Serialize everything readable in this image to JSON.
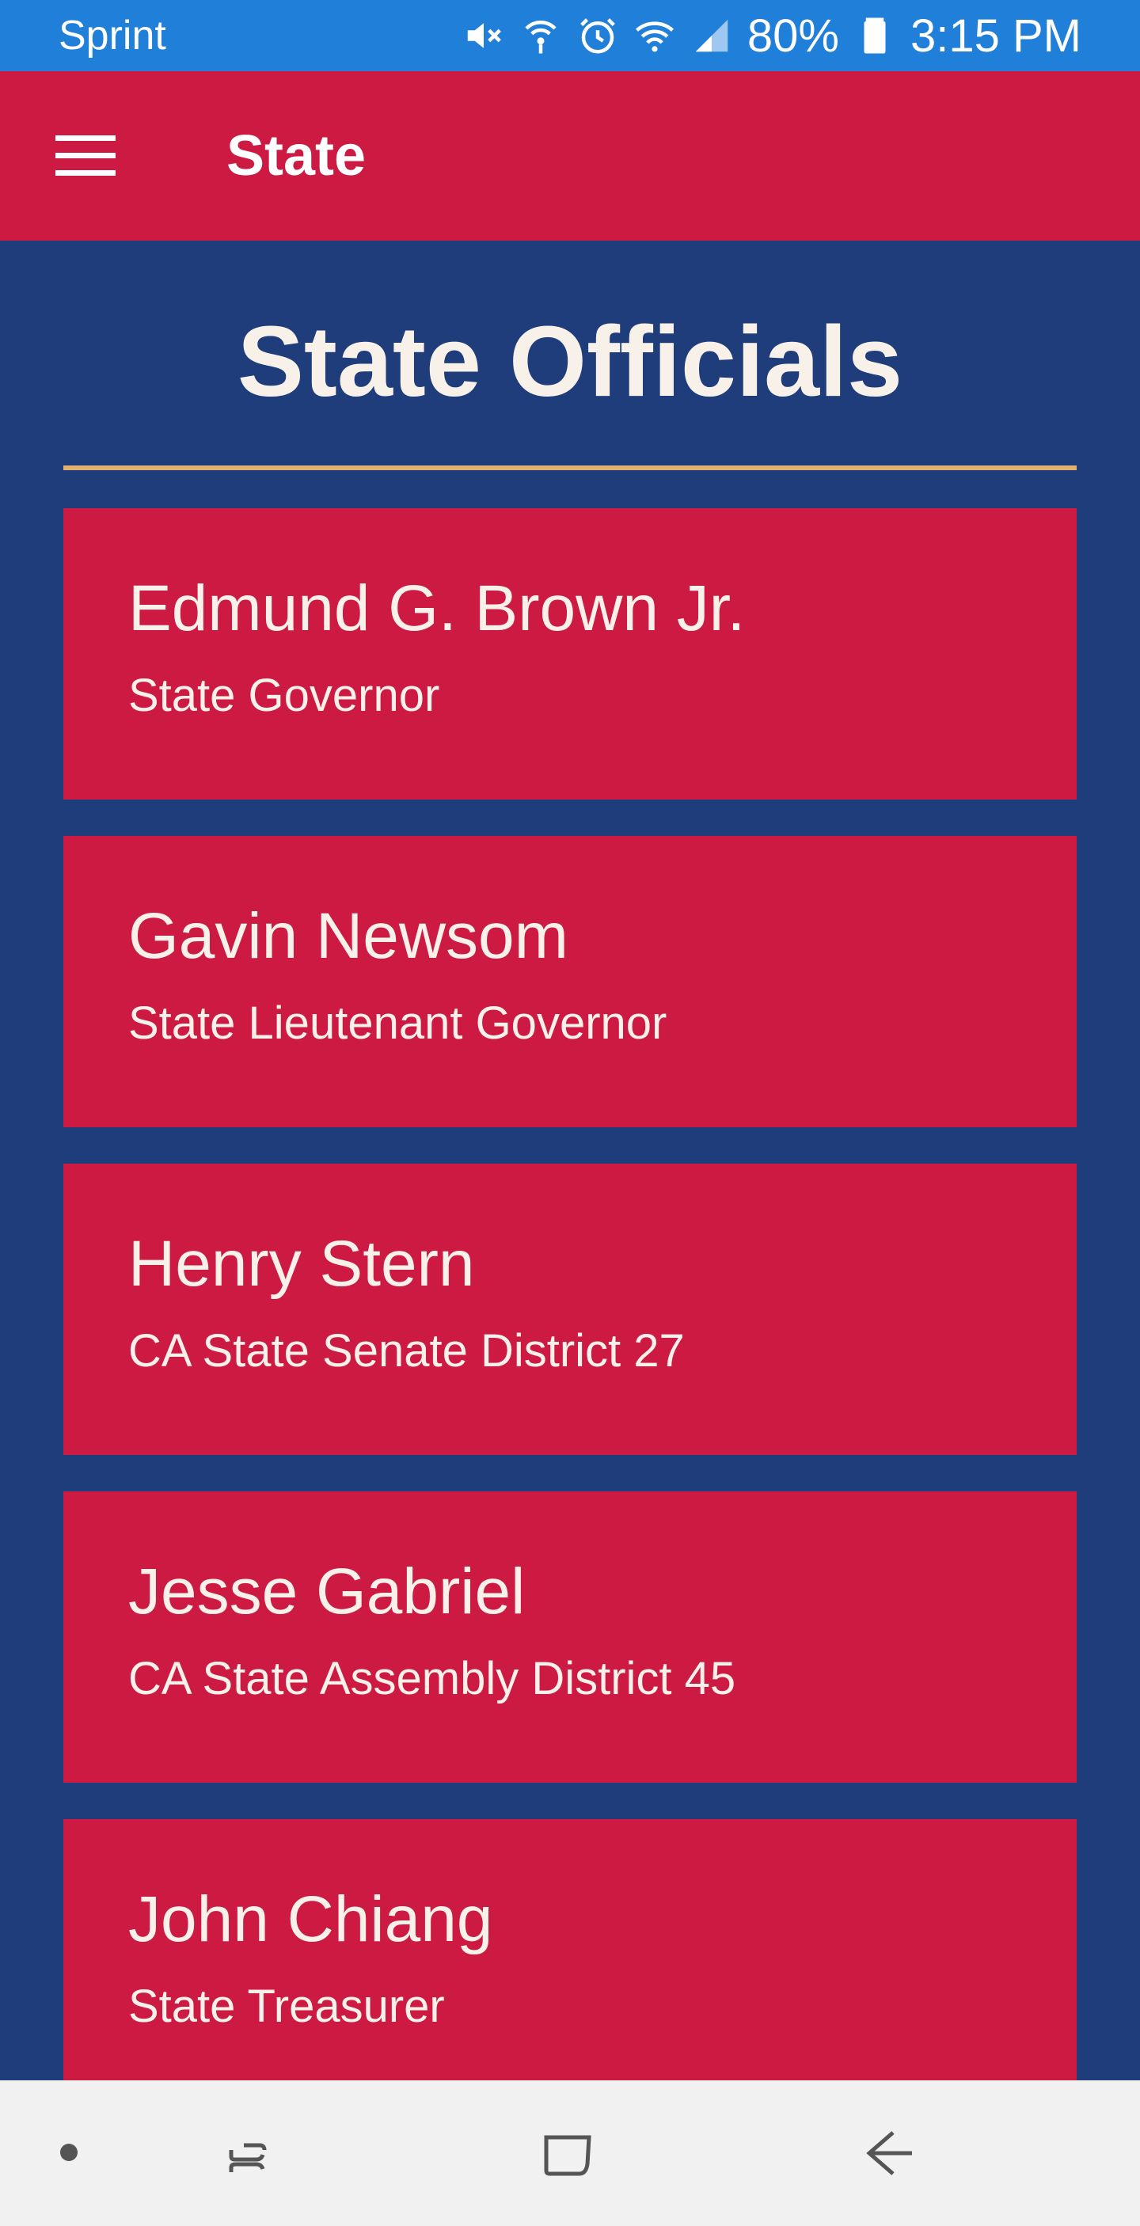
{
  "status_bar": {
    "carrier": "Sprint",
    "battery": "80%",
    "time": "3:15 PM",
    "icons": [
      "mute-icon",
      "hotspot-icon",
      "alarm-icon",
      "wifi-icon",
      "signal-icon",
      "battery-icon"
    ]
  },
  "app_bar": {
    "title": "State",
    "menu_icon": "hamburger-menu-icon"
  },
  "page": {
    "title": "State Officials"
  },
  "officials": [
    {
      "name": "Edmund G. Brown Jr.",
      "office": "State Governor"
    },
    {
      "name": "Gavin Newsom",
      "office": "State Lieutenant Governor"
    },
    {
      "name": "Henry Stern",
      "office": "CA State Senate District 27"
    },
    {
      "name": "Jesse Gabriel",
      "office": "CA State Assembly District 45"
    },
    {
      "name": "John Chiang",
      "office": "State Treasurer"
    }
  ],
  "nav_bar": {
    "icons": [
      "dot-icon",
      "recent-apps-icon",
      "home-icon",
      "back-icon"
    ]
  },
  "colors": {
    "status_bar": "#1f7fd9",
    "app_bar": "#cc1a42",
    "background": "#1f3d7a",
    "card": "#cc1a42",
    "divider": "#e2b170",
    "text": "#f7f1ea"
  }
}
